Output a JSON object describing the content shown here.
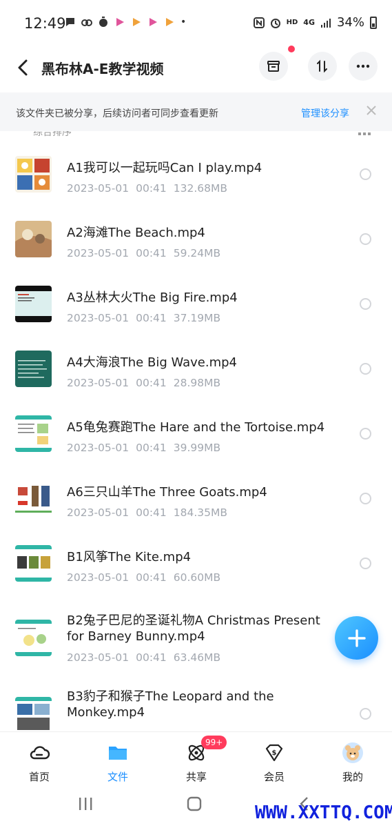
{
  "status_bar": {
    "time": "12:49",
    "hd": "HD",
    "net": "4G",
    "battery": "34%"
  },
  "header": {
    "title": "黑布林A-E教学视频"
  },
  "banner": {
    "text": "该文件夹已被分享，后续访问者可同步查看更新",
    "link": "管理该分享"
  },
  "sort": {
    "label": "综合排序"
  },
  "files": [
    {
      "name": "A1我可以一起玩吗Can I play.mp4",
      "date": "2023-05-01",
      "time": "00:41",
      "size": "132.68MB"
    },
    {
      "name": "A2海滩The Beach.mp4",
      "date": "2023-05-01",
      "time": "00:41",
      "size": "59.24MB"
    },
    {
      "name": "A3丛林大火The Big Fire.mp4",
      "date": "2023-05-01",
      "time": "00:41",
      "size": "37.19MB"
    },
    {
      "name": "A4大海浪The Big Wave.mp4",
      "date": "2023-05-01",
      "time": "00:41",
      "size": "28.98MB"
    },
    {
      "name": "A5龟兔赛跑The Hare and the Tortoise.mp4",
      "date": "2023-05-01",
      "time": "00:41",
      "size": "39.99MB"
    },
    {
      "name": "A6三只山羊The Three Goats.mp4",
      "date": "2023-05-01",
      "time": "00:41",
      "size": "184.35MB"
    },
    {
      "name": "B1风筝The Kite.mp4",
      "date": "2023-05-01",
      "time": "00:41",
      "size": "60.60MB"
    },
    {
      "name": "B2兔子巴尼的圣诞礼物A Christmas Present for Barney Bunny.mp4",
      "date": "2023-05-01",
      "time": "00:41",
      "size": "63.46MB"
    },
    {
      "name": "B3豹子和猴子The Leopard and the Monkey.mp4",
      "date": "",
      "time": "",
      "size": ""
    }
  ],
  "bottom_nav": {
    "home": "首页",
    "files": "文件",
    "share": "共享",
    "vip": "会员",
    "me": "我的",
    "share_badge": "99+"
  },
  "watermark": "WWW.XXTTQ.COM",
  "colors": {
    "accent": "#1e90ff",
    "badge": "#ff3b5c",
    "meta_text": "#a3a8b0"
  }
}
